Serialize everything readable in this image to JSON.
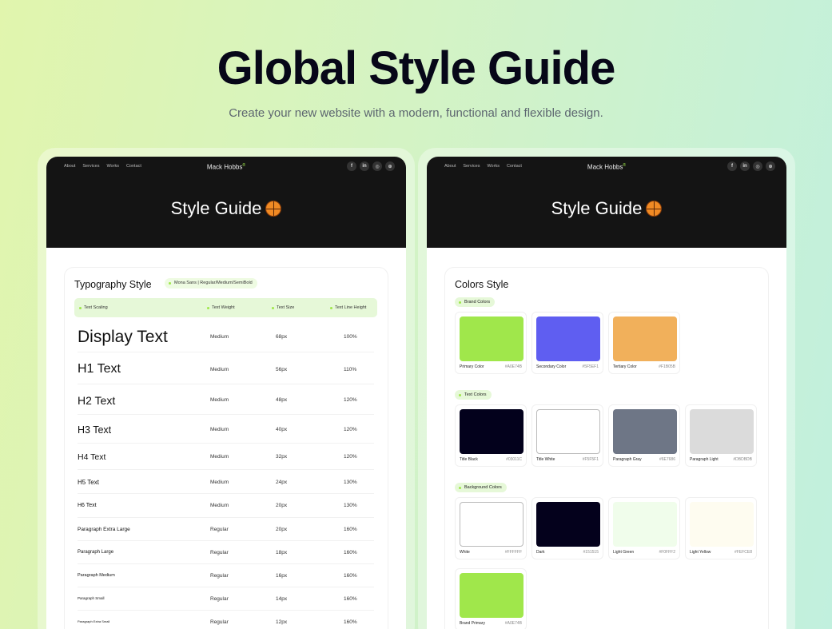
{
  "page": {
    "title": "Global Style Guide",
    "subtitle": "Create your new website with a modern, functional and flexible design."
  },
  "mockup": {
    "nav": [
      "About",
      "Services",
      "Works",
      "Contact"
    ],
    "brand": "Mack Hobbs",
    "brand_mark": "®",
    "socials": [
      {
        "icon": "facebook-icon",
        "glyph": "f"
      },
      {
        "icon": "linkedin-icon",
        "glyph": "in"
      },
      {
        "icon": "instagram-icon",
        "glyph": "◎"
      },
      {
        "icon": "dribbble-icon",
        "glyph": "⊛"
      }
    ],
    "header_title": "Style Guide",
    "header_icon": "basketball-icon"
  },
  "typography": {
    "title": "Typography Style",
    "font_pill": "Mona Sans | Regular/Medium/SemiBold",
    "columns": [
      "Text Scaling",
      "Text Weight",
      "Text Size",
      "Text Line Height"
    ],
    "rows": [
      {
        "name": "Display Text",
        "weight": "Medium",
        "size": "68px",
        "line": "100%"
      },
      {
        "name": "H1 Text",
        "weight": "Medium",
        "size": "56px",
        "line": "110%"
      },
      {
        "name": "H2 Text",
        "weight": "Medium",
        "size": "48px",
        "line": "120%"
      },
      {
        "name": "H3 Text",
        "weight": "Medium",
        "size": "40px",
        "line": "120%"
      },
      {
        "name": "H4 Text",
        "weight": "Medium",
        "size": "32px",
        "line": "120%"
      },
      {
        "name": "H5 Text",
        "weight": "Medium",
        "size": "24px",
        "line": "130%"
      },
      {
        "name": "H6 Text",
        "weight": "Medium",
        "size": "20px",
        "line": "130%"
      },
      {
        "name": "Paragraph Extra Large",
        "weight": "Regular",
        "size": "20px",
        "line": "160%"
      },
      {
        "name": "Paragraph Large",
        "weight": "Regular",
        "size": "18px",
        "line": "160%"
      },
      {
        "name": "Paragraph Medium",
        "weight": "Regular",
        "size": "16px",
        "line": "160%"
      },
      {
        "name": "Paragraph Small",
        "weight": "Regular",
        "size": "14px",
        "line": "160%"
      },
      {
        "name": "Paragraph Extra Small",
        "weight": "Regular",
        "size": "12px",
        "line": "160%"
      }
    ]
  },
  "colors": {
    "title": "Colors Style",
    "groups": [
      {
        "label": "Brand Colors",
        "swatches": [
          {
            "name": "Primary Color",
            "hex": "#A0E74B",
            "color": "#A0E74B"
          },
          {
            "name": "Secondary Color",
            "hex": "#5F5EF1",
            "color": "#5F5EF1"
          },
          {
            "name": "Tertiary Color",
            "hex": "#F1B05B",
            "color": "#F1B05B"
          }
        ]
      },
      {
        "label": "Text Colors",
        "swatches": [
          {
            "name": "Title Black",
            "hex": "#03011C",
            "color": "#03011C"
          },
          {
            "name": "Title White",
            "hex": "#F5F5F1",
            "color": "#FFFFFF"
          },
          {
            "name": "Paragraph Gray",
            "hex": "#6E7686",
            "color": "#6E7686"
          },
          {
            "name": "Paragraph Light",
            "hex": "#DBDBDB",
            "color": "#DBDBDB"
          }
        ]
      },
      {
        "label": "Background Colors",
        "swatches": [
          {
            "name": "White",
            "hex": "#FFFFFF",
            "color": "#FFFFFF"
          },
          {
            "name": "Dark",
            "hex": "#151515",
            "color": "#04011C"
          },
          {
            "name": "Light Green",
            "hex": "#F0FFF2",
            "color": "#F0FDEB"
          },
          {
            "name": "Light Yellow",
            "hex": "#FEFCE8",
            "color": "#FEFCF0"
          },
          {
            "name": "Brand Primary",
            "hex": "#A0E74B",
            "color": "#A0E74B"
          }
        ]
      }
    ]
  }
}
